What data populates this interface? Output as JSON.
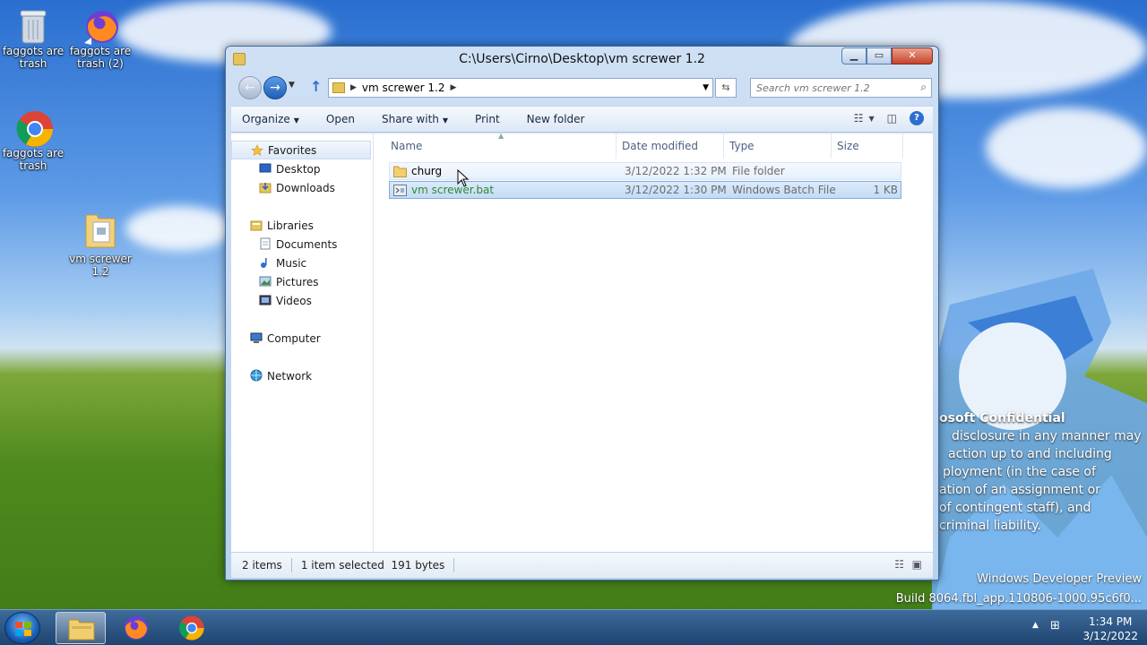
{
  "desktop": {
    "icons": [
      {
        "label": "faggots are trash"
      },
      {
        "label": "faggots are trash (2)"
      },
      {
        "label": "faggots are trash"
      },
      {
        "label": "vm screwer 1.2"
      }
    ],
    "watermark": {
      "line1": "osoft Confidential",
      "line2": "disclosure in any manner may",
      "line3": "action up to and including",
      "line4": "ployment (in the case of",
      "line5": "ation of an assignment or",
      "line6": "of contingent staff), and",
      "line7": "criminal liability.",
      "build1": "Windows Developer Preview",
      "build2": "Build 8064.fbl_app.110806-1000.95c6f0..."
    }
  },
  "window": {
    "title": "C:\\Users\\Cirno\\Desktop\\vm screwer 1.2",
    "address_segment": "vm screwer 1.2",
    "search_placeholder": "Search vm screwer 1.2",
    "toolbar": {
      "organize": "Organize",
      "open": "Open",
      "share_with": "Share with",
      "print": "Print",
      "new_folder": "New folder"
    },
    "nav": {
      "favorites": "Favorites",
      "desktop": "Desktop",
      "downloads": "Downloads",
      "libraries": "Libraries",
      "documents": "Documents",
      "music": "Music",
      "pictures": "Pictures",
      "videos": "Videos",
      "computer": "Computer",
      "network": "Network"
    },
    "columns": {
      "name": "Name",
      "date_modified": "Date modified",
      "type": "Type",
      "size": "Size"
    },
    "files": [
      {
        "name": "churg",
        "date": "3/12/2022 1:32 PM",
        "type": "File folder",
        "size": ""
      },
      {
        "name": "vm screwer.bat",
        "date": "3/12/2022 1:30 PM",
        "type": "Windows Batch File",
        "size": "1 KB"
      }
    ],
    "status": {
      "items": "2 items",
      "selection": "1 item selected  191 bytes"
    }
  },
  "taskbar": {
    "time": "1:34 PM",
    "date": "3/12/2022"
  },
  "colors": {
    "accent": "#2d6fd1",
    "selection": "#c3dbf6",
    "batch_text": "#2e8b2e"
  }
}
